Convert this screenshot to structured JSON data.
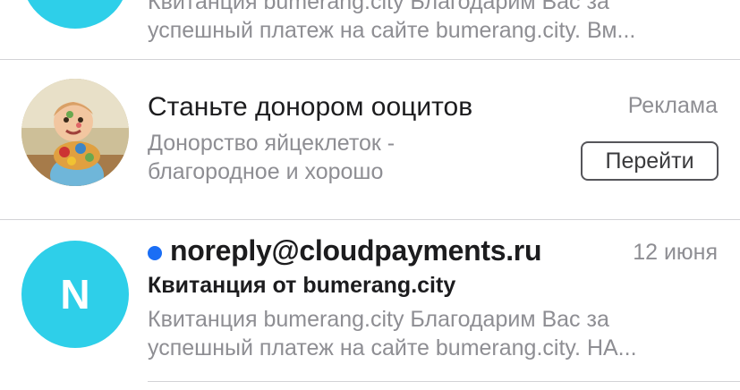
{
  "colors": {
    "avatar_bg": "#2ecfe9",
    "unread_dot": "#1a6ef5",
    "primary_text": "#1c1c1e",
    "secondary_text": "#8e8e93"
  },
  "messages": [
    {
      "avatar_icon": "avatar-circle",
      "preview_line1": "Квитанция bumerang.city Благодарим Вас за",
      "preview_line2": "успешный платеж на сайте bumerang.city. Вм..."
    },
    {
      "type": "ad",
      "avatar_icon": "child-photo-avatar",
      "title": "Станьте донором ооцитов",
      "label": "Реклама",
      "preview_line1": "Донорство яйцеклеток -",
      "preview_line2": "благородное и хорошо",
      "button_label": "Перейти"
    },
    {
      "unread": true,
      "avatar_letter": "N",
      "sender": "noreply@cloudpayments.ru",
      "date": "12 июня",
      "subject": "Квитанция от bumerang.city",
      "preview_line1": "Квитанция bumerang.city Благодарим Вас за",
      "preview_line2": "успешный платеж на сайте bumerang.city. НА..."
    }
  ]
}
